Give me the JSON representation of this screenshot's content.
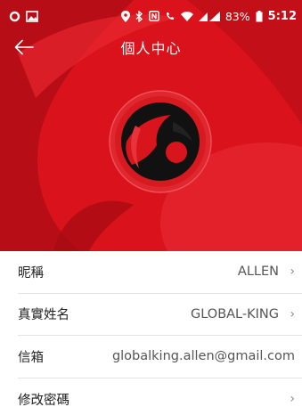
{
  "status_bar": {
    "battery_percent": "83%",
    "time": "5:12"
  },
  "header": {
    "title": "個人中心"
  },
  "profile_rows": [
    {
      "label": "昵稱",
      "value": "ALLEN",
      "has_chevron": true
    },
    {
      "label": "真實姓名",
      "value": "GLOBAL-KING",
      "has_chevron": true
    },
    {
      "label": "信箱",
      "value": "globalking.allen@gmail.com",
      "has_chevron": false
    },
    {
      "label": "修改密碼",
      "value": "",
      "has_chevron": true
    }
  ],
  "colors": {
    "brand_red": "#d9121b",
    "dark_red": "#b30d15",
    "text": "#222222",
    "value_text": "#555555",
    "divider": "#e3e3e3"
  }
}
